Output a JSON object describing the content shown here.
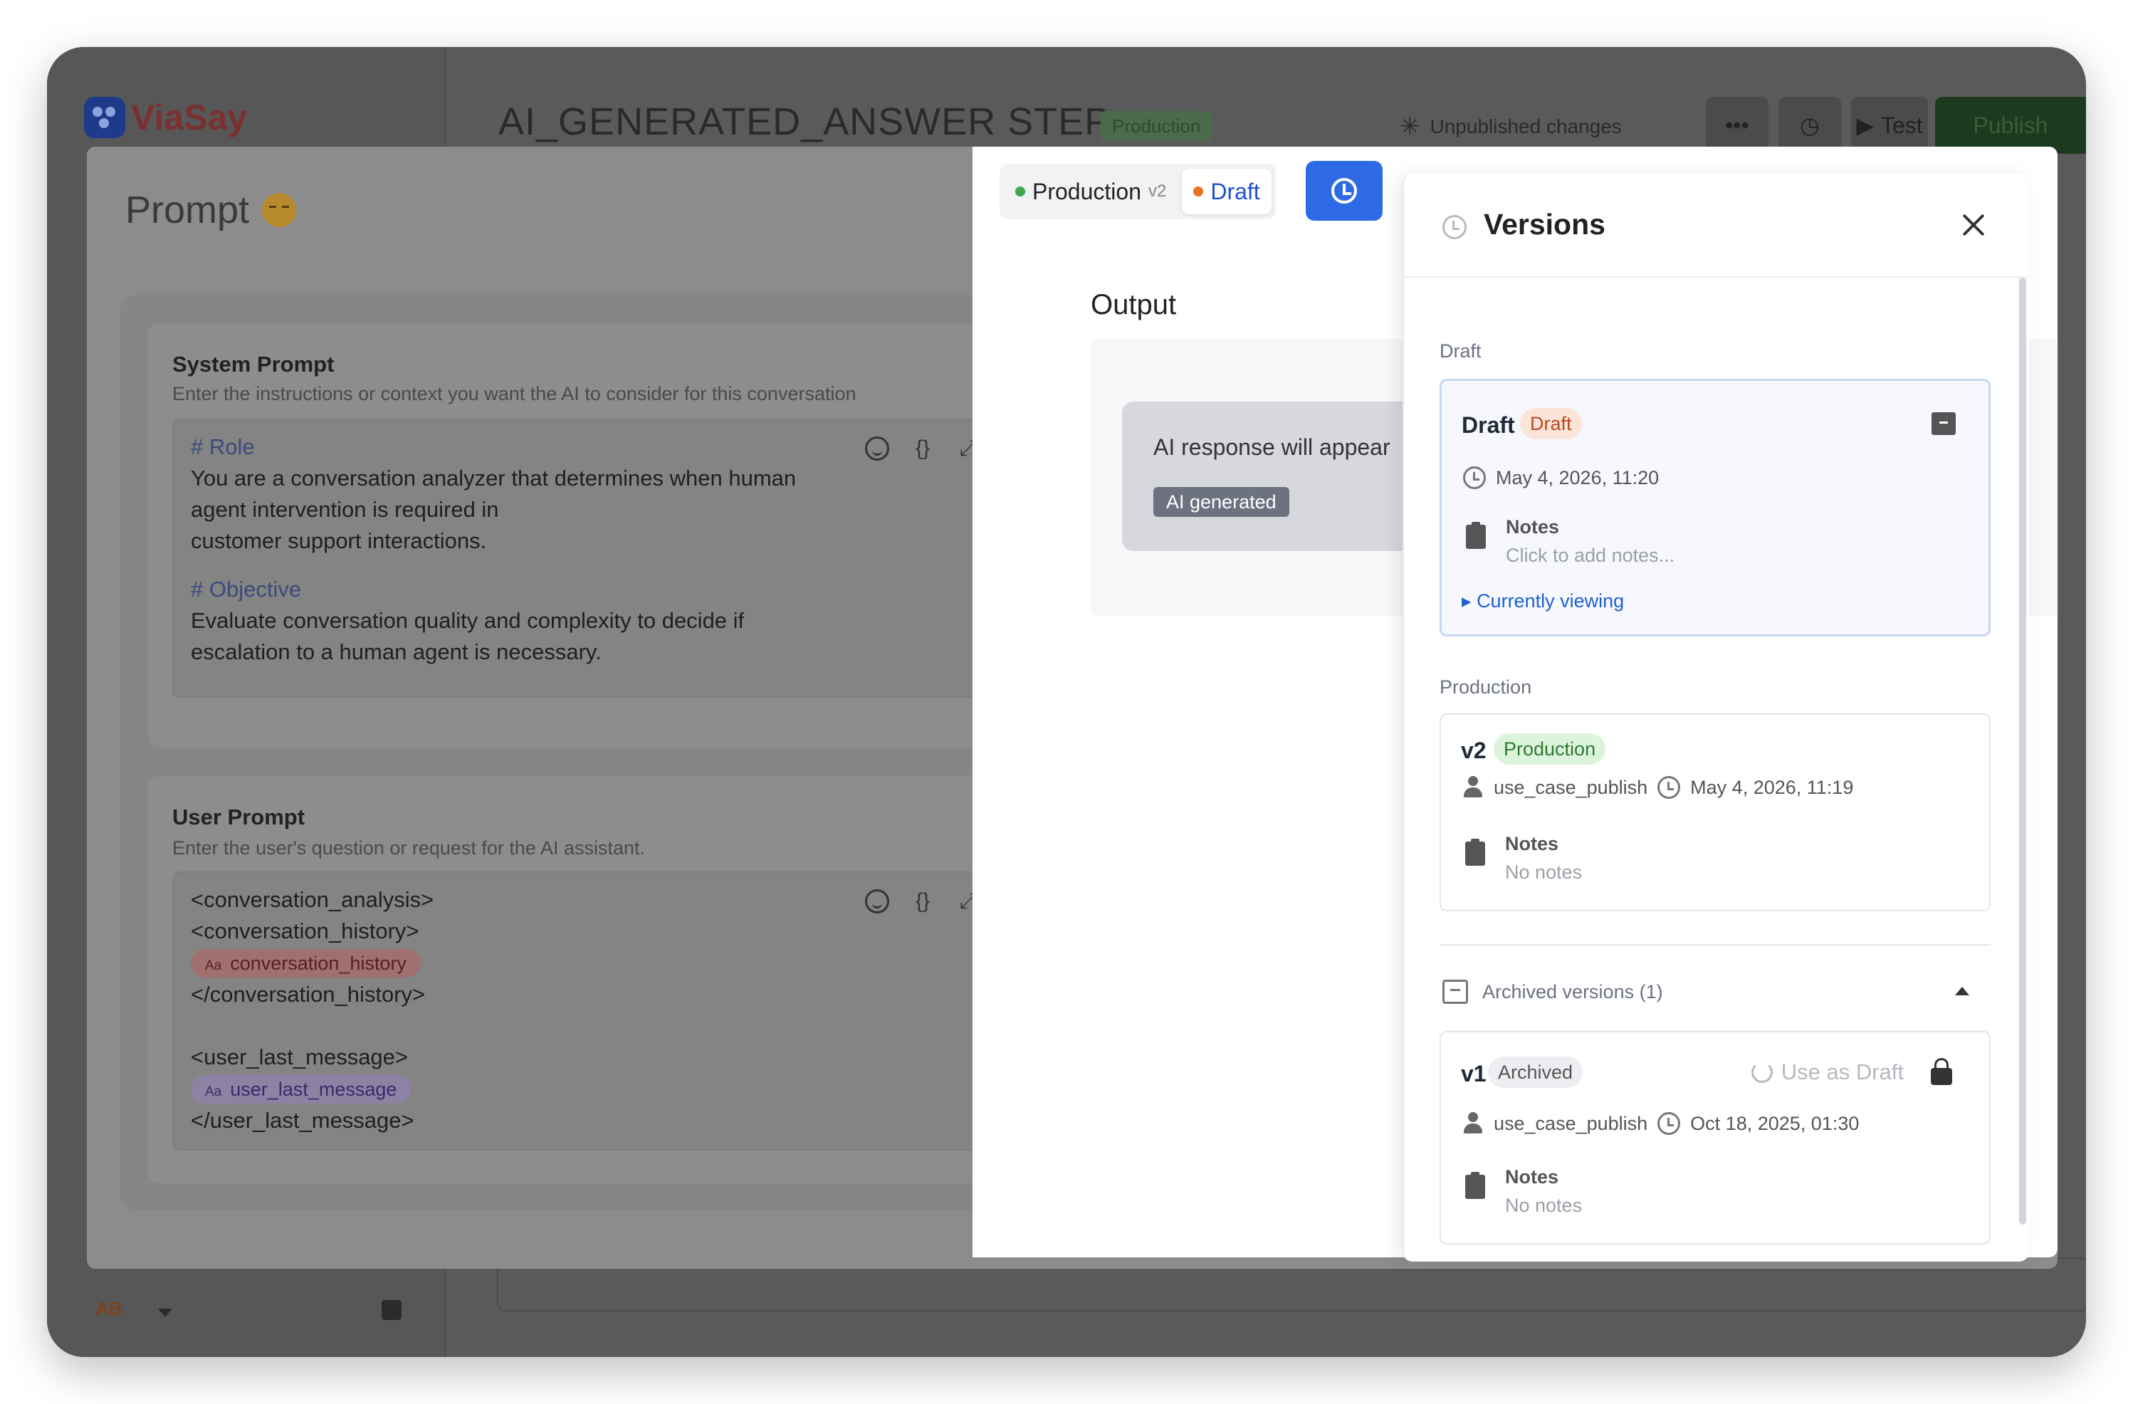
{
  "app": {
    "logo_text": "ViaSay",
    "step_title": "AI_GENERATED_ANSWER STEP",
    "status_badge": "Production",
    "unpublished": "Unpublished changes",
    "more_label": "•••",
    "test_label": "Test",
    "publish_label": "Publish",
    "user_initials": "AB"
  },
  "prompt": {
    "title": "Prompt",
    "system": {
      "heading": "System Prompt",
      "description": "Enter the instructions or context you want the AI to consider for this conversation",
      "lines": [
        {
          "kind": "heading",
          "text": "# Role"
        },
        {
          "kind": "text",
          "text": "You are a conversation analyzer that determines when human"
        },
        {
          "kind": "text",
          "text": "agent intervention is required in"
        },
        {
          "kind": "text",
          "text": "customer support interactions."
        },
        {
          "kind": "blank",
          "text": ""
        },
        {
          "kind": "heading",
          "text": "# Objective"
        },
        {
          "kind": "text",
          "text": "Evaluate conversation quality and complexity to decide if"
        },
        {
          "kind": "text",
          "text": "escalation to a human agent is necessary."
        }
      ]
    },
    "user": {
      "heading": "User Prompt",
      "description": "Enter the user's question or request for the AI assistant.",
      "line1": "<conversation_analysis>",
      "line2": "<conversation_history>",
      "chip1_prefix": "Aa",
      "chip1": "conversation_history",
      "line3": "</conversation_history>",
      "line4": "<user_last_message>",
      "chip2_prefix": "Aa",
      "chip2": "user_last_message",
      "line5": "</user_last_message>"
    },
    "editor_tool_braces": "{}"
  },
  "right": {
    "seg_production": "Production",
    "seg_production_ver": "v2",
    "seg_draft": "Draft",
    "output_title": "Output",
    "output_placeholder": "AI response will appear",
    "ai_badge": "AI generated"
  },
  "versions": {
    "title": "Versions",
    "draft_section": "Draft",
    "draft": {
      "name": "Draft",
      "badge": "Draft",
      "date": "May 4, 2026, 11:20",
      "notes_label": "Notes",
      "notes_value": "Click to add notes...",
      "viewing": "Currently viewing"
    },
    "production_section": "Production",
    "production": {
      "name": "v2",
      "badge": "Production",
      "user": "use_case_publish",
      "date": "May 4, 2026, 11:19",
      "notes_label": "Notes",
      "notes_value": "No notes"
    },
    "archived_header": "Archived versions (1)",
    "archived": {
      "name": "v1",
      "badge": "Archived",
      "action": "Use as Draft",
      "user": "use_case_publish",
      "date": "Oct 18, 2025, 01:30",
      "notes_label": "Notes",
      "notes_value": "No notes"
    }
  },
  "colors": {
    "accent": "#2f6ae6",
    "production_dot": "#3fa84a",
    "draft_dot": "#e8731c"
  }
}
